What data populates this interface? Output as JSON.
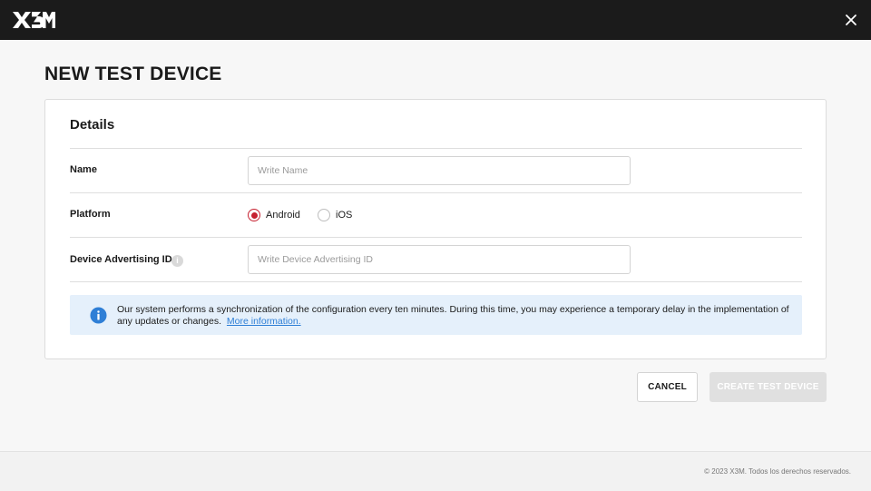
{
  "app": {
    "logo_text": "X3M"
  },
  "page": {
    "title": "NEW TEST DEVICE"
  },
  "details": {
    "title": "Details",
    "name": {
      "label": "Name",
      "placeholder": "Write Name",
      "value": ""
    },
    "platform": {
      "label": "Platform",
      "options": [
        {
          "label": "Android",
          "selected": true
        },
        {
          "label": "iOS",
          "selected": false
        }
      ]
    },
    "advertising_id": {
      "label": "Device Advertising ID",
      "info_glyph": "i",
      "placeholder": "Write Device Advertising ID",
      "value": ""
    },
    "notice": {
      "text": "Our system performs a synchronization of the configuration every ten minutes. During this time, you may experience a temporary delay in the implementation of any updates or changes.",
      "link": "More information."
    }
  },
  "actions": {
    "cancel_label": "CANCEL",
    "create_label": "CREATE TEST DEVICE",
    "create_enabled": false
  },
  "footer": {
    "copyright": "© 2023 X3M. Todos los derechos reservados."
  },
  "colors": {
    "topbar": "#1b1b1b",
    "accent": "#c62130",
    "info_blue": "#2f7fd6",
    "notice_bg": "#e5f0fb",
    "disabled_button": "#e0e0e0"
  },
  "icons": {
    "close": "close-icon",
    "info": "info-icon",
    "field_info": "info-circle-icon"
  }
}
